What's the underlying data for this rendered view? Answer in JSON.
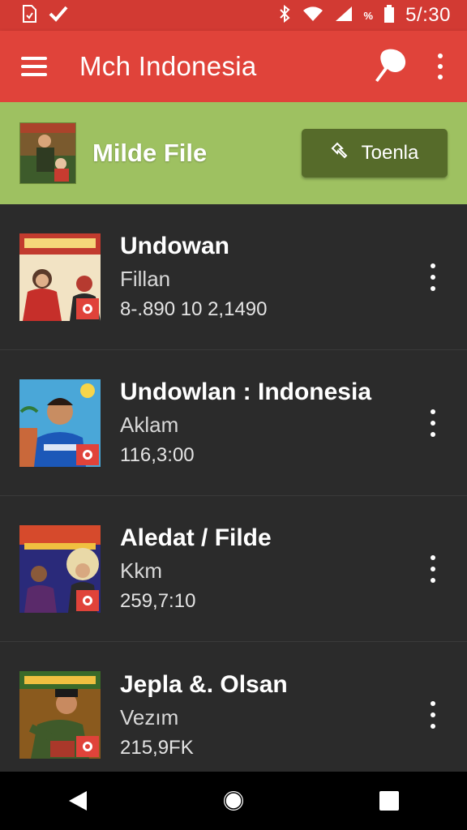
{
  "status_bar": {
    "time": "5/:30",
    "percent_label": "%",
    "icons": [
      "sd-card-icon",
      "checkmark-icon",
      "bluetooth-icon",
      "wifi-icon",
      "signal-icon",
      "battery-icon"
    ]
  },
  "app_bar": {
    "title": "Mch Indonesia",
    "icons": [
      "hamburger-menu-icon",
      "profile-badge-icon",
      "overflow-menu-icon"
    ]
  },
  "banner": {
    "title": "Milde File",
    "button_label": "Toenla",
    "button_icon": "pin-icon"
  },
  "items": [
    {
      "title": "Undowan",
      "subtitle": "Fillan",
      "meta": "8-.890  10 2,1490"
    },
    {
      "title": "Undowlan : Indonesia",
      "subtitle": "Aklam",
      "meta": "116,3:00"
    },
    {
      "title": "Aledat / Filde",
      "subtitle": "Kkm",
      "meta": "259,7:10"
    },
    {
      "title": "Jepla &. Olsan",
      "subtitle": "Vezım",
      "meta": "215,9FK"
    }
  ],
  "colors": {
    "status_bar": "#d23a33",
    "app_bar": "#e0433a",
    "banner": "#9ec161",
    "banner_button": "#566b2a",
    "list_bg": "#2b2b2b",
    "nav_bar": "#000000"
  },
  "nav": [
    "back-icon",
    "home-icon",
    "recents-icon"
  ]
}
